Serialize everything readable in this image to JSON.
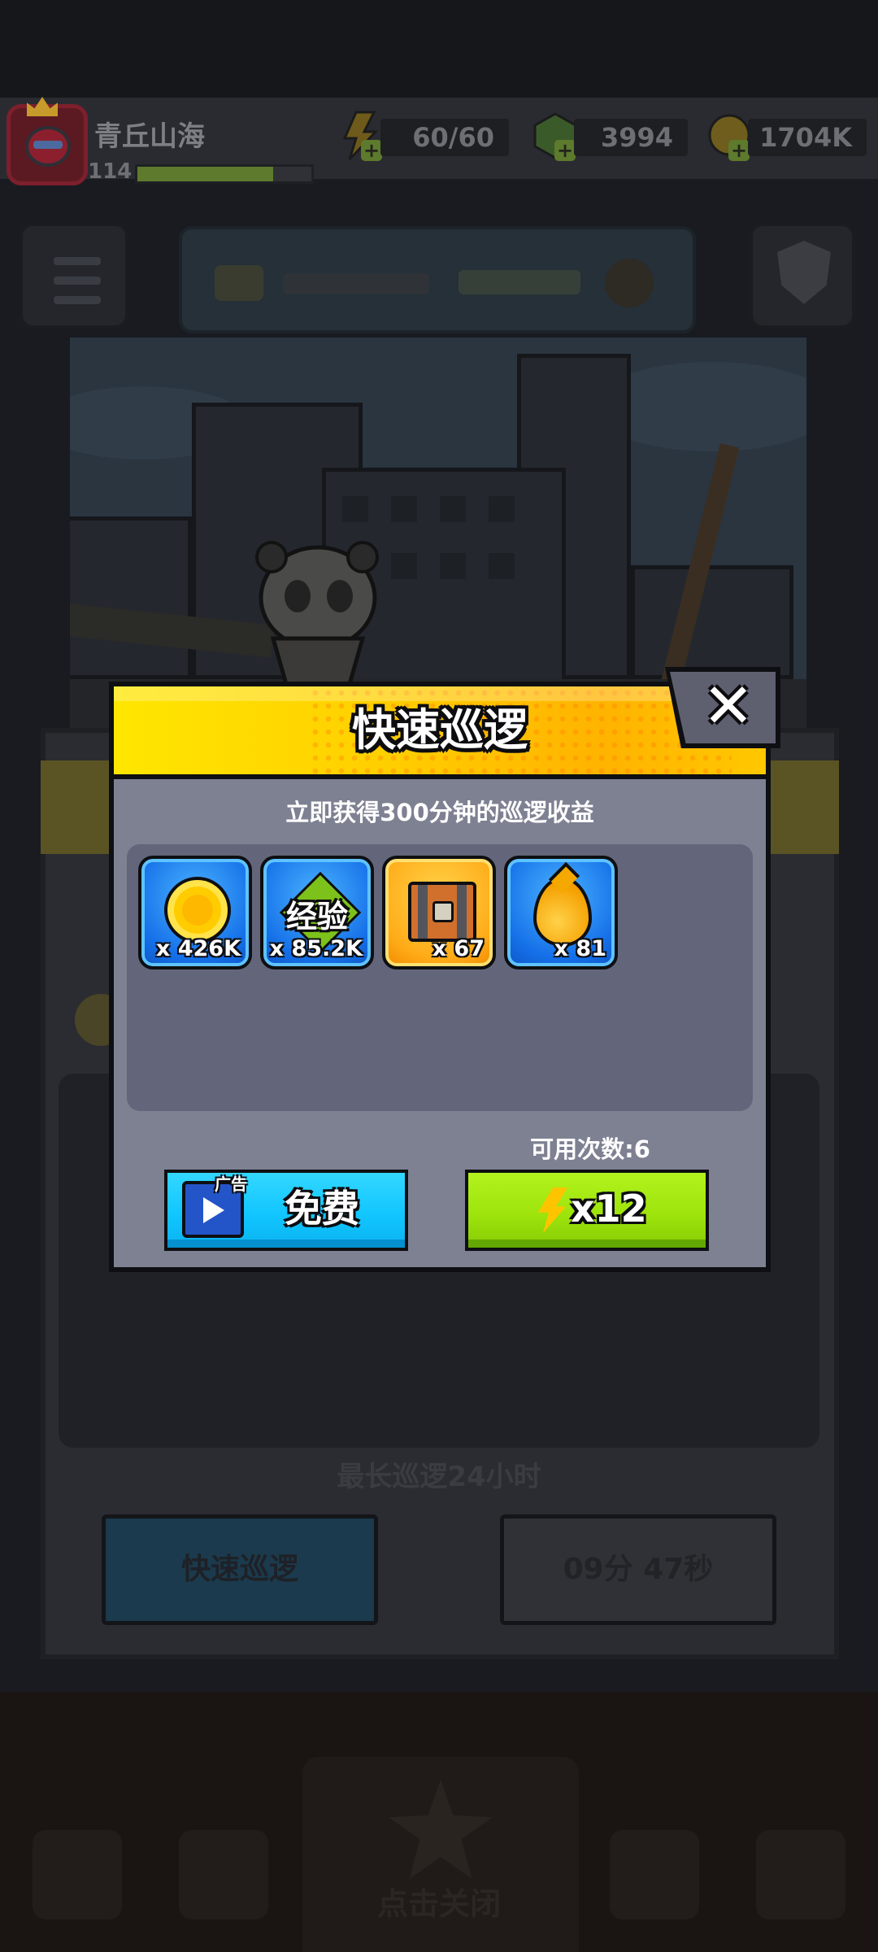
{
  "player": {
    "name": "青丘山海",
    "level": "114",
    "xp_fill": 0.78
  },
  "resources": {
    "energy": "60/60",
    "gems": "3994",
    "gold": "1704K"
  },
  "background": {
    "max_patrol_text": "最长巡逻24小时",
    "quick_patrol_button": "快速巡逻",
    "timer": "09分 47秒",
    "tap_close": "点击关闭"
  },
  "modal": {
    "title": "快速巡逻",
    "subtitle": "立即获得300分钟的巡逻收益",
    "close_symbol": "✕",
    "rewards": [
      {
        "icon": "gold-coin-icon",
        "quantity": "x 426K"
      },
      {
        "icon": "experience-gem-icon",
        "label": "经验",
        "quantity": "x 85.2K"
      },
      {
        "icon": "treasure-chest-icon",
        "quantity": "x 67"
      },
      {
        "icon": "oil-drop-icon",
        "quantity": "x 81"
      }
    ],
    "uses_remaining": "可用次数:6",
    "free_button": {
      "ad_tag": "广告",
      "label": "免费"
    },
    "energy_button": {
      "label": "x12"
    }
  },
  "colors": {
    "header_yellow": "#ffd400",
    "free_button": "#12c6ff",
    "energy_button": "#9ee40c",
    "modal_body": "#7e8192"
  }
}
